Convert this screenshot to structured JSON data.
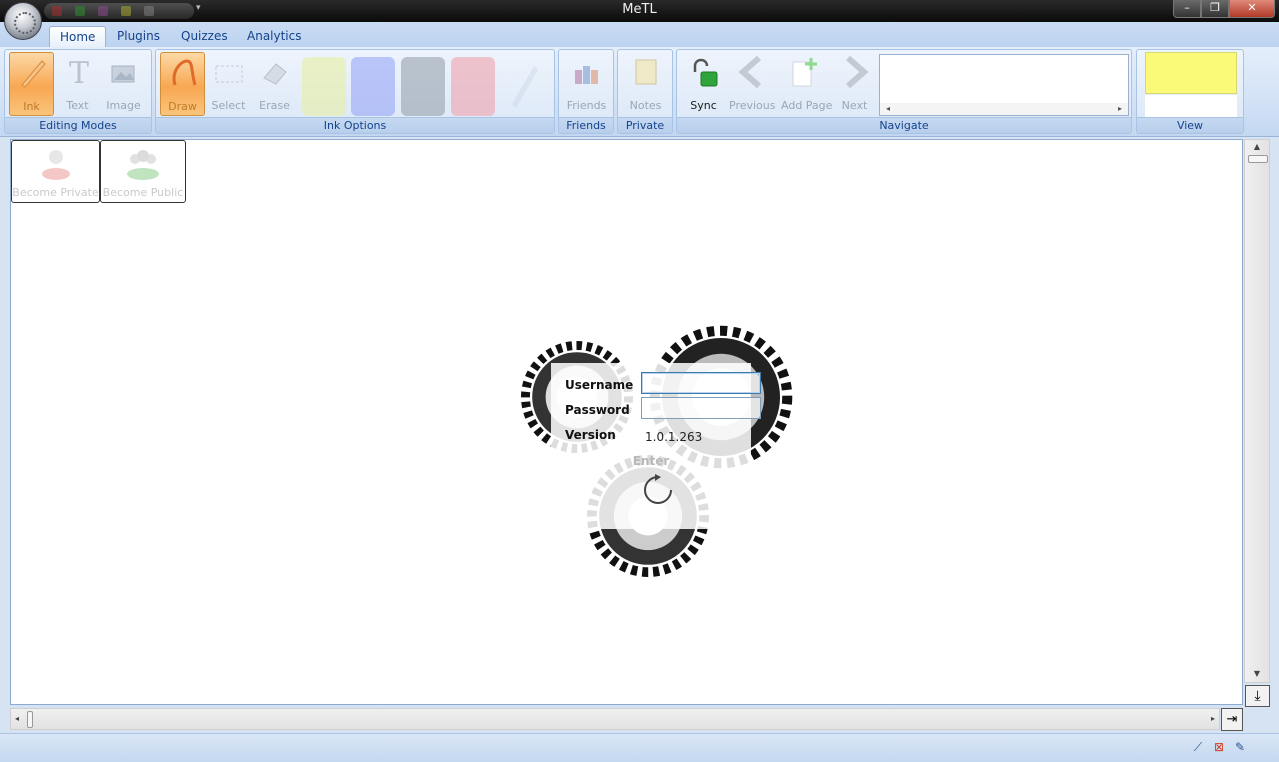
{
  "window": {
    "title": "MeTL",
    "controls": {
      "minimize": "–",
      "restore": "❐",
      "close": "✕"
    },
    "qat_more": "▾"
  },
  "tabs": [
    {
      "label": "Home",
      "active": true
    },
    {
      "label": "Plugins"
    },
    {
      "label": "Quizzes"
    },
    {
      "label": "Analytics"
    }
  ],
  "ribbon": {
    "editing_modes": {
      "label": "Editing Modes",
      "buttons": [
        "Ink",
        "Text",
        "Image"
      ]
    },
    "ink_options": {
      "label": "Ink Options",
      "buttons": [
        "Draw",
        "Select",
        "Erase"
      ],
      "pen_colors": [
        "#e8ef9a",
        "#8f9ef5",
        "#909aa6",
        "#ee9aa6"
      ]
    },
    "friends": {
      "label": "Friends",
      "button": "Friends"
    },
    "private": {
      "label": "Private",
      "button": "Notes"
    },
    "navigate": {
      "label": "Navigate",
      "buttons": [
        "Sync",
        "Previous",
        "Add Page",
        "Next"
      ],
      "scroll_left": "◂",
      "scroll_right": "▸"
    },
    "view": {
      "label": "View"
    }
  },
  "privacy": {
    "become_private": "Become Private",
    "become_public": "Become Public"
  },
  "login": {
    "username_label": "Username",
    "password_label": "Password",
    "version_label": "Version",
    "version": "1.0.1.263",
    "enter": "Enter",
    "username_value": "",
    "password_value": ""
  },
  "scrollbars": {
    "up": "▲",
    "down": "▼",
    "left": "◂",
    "right": "▸",
    "v_end": "⤓",
    "h_end": "⇥"
  },
  "status_icons": [
    "pen-icon",
    "cancel-icon",
    "pin-icon"
  ]
}
